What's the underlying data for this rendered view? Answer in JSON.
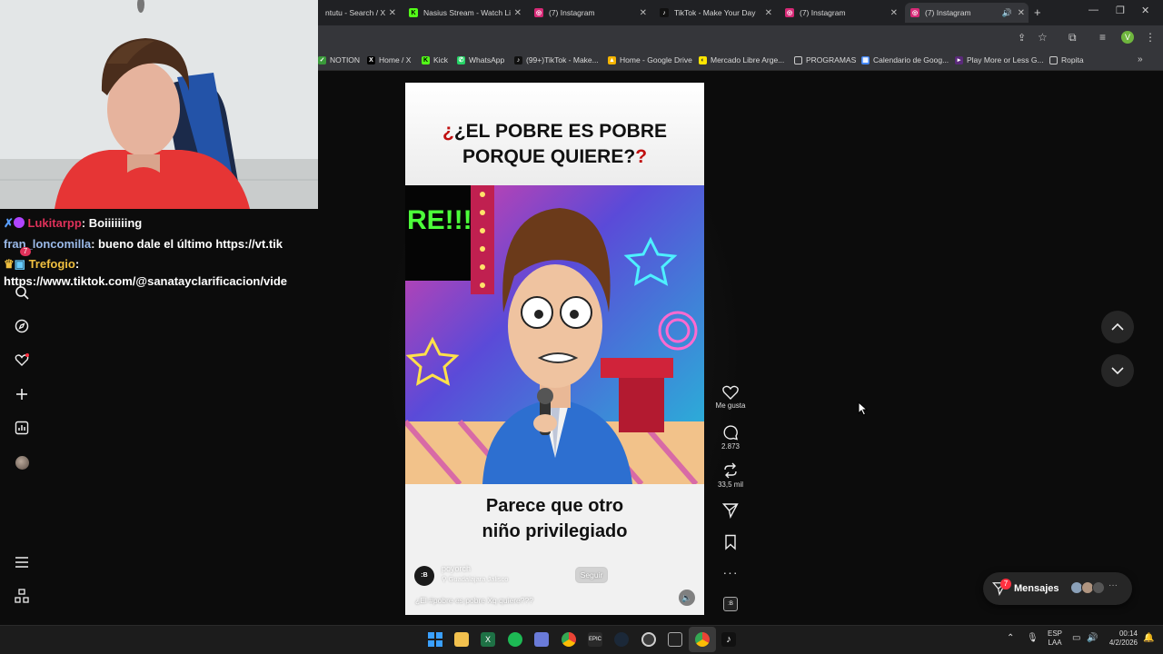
{
  "tabs": [
    {
      "label": "ntutu - Search / X",
      "icon": "x-icon",
      "color": "#000000"
    },
    {
      "label": "Nasius Stream - Watch Li",
      "icon": "kick-icon",
      "color": "#53fc18"
    },
    {
      "label": "(7) Instagram",
      "icon": "instagram-icon",
      "color": "#d62976"
    },
    {
      "label": "TikTok - Make Your Day",
      "icon": "tiktok-icon",
      "color": "#111111"
    },
    {
      "label": "(7) Instagram",
      "icon": "instagram-icon",
      "color": "#d62976"
    },
    {
      "label": "(7) Instagram",
      "icon": "instagram-icon",
      "color": "#d62976"
    }
  ],
  "bookmarks": [
    {
      "label": "NOTION",
      "icon": "check-icon"
    },
    {
      "label": "Home / X",
      "icon": "x-icon"
    },
    {
      "label": "Kick",
      "icon": "kick-icon"
    },
    {
      "label": "WhatsApp",
      "icon": "whatsapp-icon"
    },
    {
      "label": "(99+)TikTok - Make...",
      "icon": "tiktok-icon"
    },
    {
      "label": "Home - Google Drive",
      "icon": "drive-icon"
    },
    {
      "label": "Mercado Libre Arge...",
      "icon": "mercadolibre-icon"
    },
    {
      "label": "PROGRAMAS",
      "icon": "folder-icon"
    },
    {
      "label": "Calendario de Goog...",
      "icon": "calendar-icon"
    },
    {
      "label": "Play More or Less G...",
      "icon": "game-icon"
    },
    {
      "label": "Ropita",
      "icon": "folder-icon"
    }
  ],
  "chat": [
    {
      "user": "Lukitarpp",
      "message": "Boiiiiiiing",
      "color": "#e0315a"
    },
    {
      "user": "fran_loncomilla",
      "message": "bueno dale el último https://vt.tik",
      "color": "#9ab9e8"
    },
    {
      "user": "Trefogio",
      "message": "",
      "color": "#f0c040"
    },
    {
      "user": "",
      "message": "https://www.tiktok.com/@sanatayclarificacion/vide",
      "color": "#ffffff"
    }
  ],
  "chat_badge": "7",
  "reel": {
    "title_line1": "¿EL POBRE ES POBRE",
    "title_line2": "PORQUE QUIERE?",
    "sign_text": "RE!!!",
    "caption_line1": "Parece que otro",
    "caption_line2": "niño privilegiado",
    "author": "poyorch",
    "location": "Guadalajara Jalisco",
    "follow_label": "Seguir",
    "description": "¿El #pobre es pobre Xq quiere???",
    "avatar_text": ":B"
  },
  "actions": {
    "like_label": "Me gusta",
    "comments": "2.873",
    "reposts": "33,5 mil"
  },
  "messages": {
    "label": "Mensajes",
    "badge": "7"
  },
  "clock": {
    "time": "00:14",
    "date": "4/2/2026",
    "lang1": "ESP",
    "lang2": "LAA"
  }
}
